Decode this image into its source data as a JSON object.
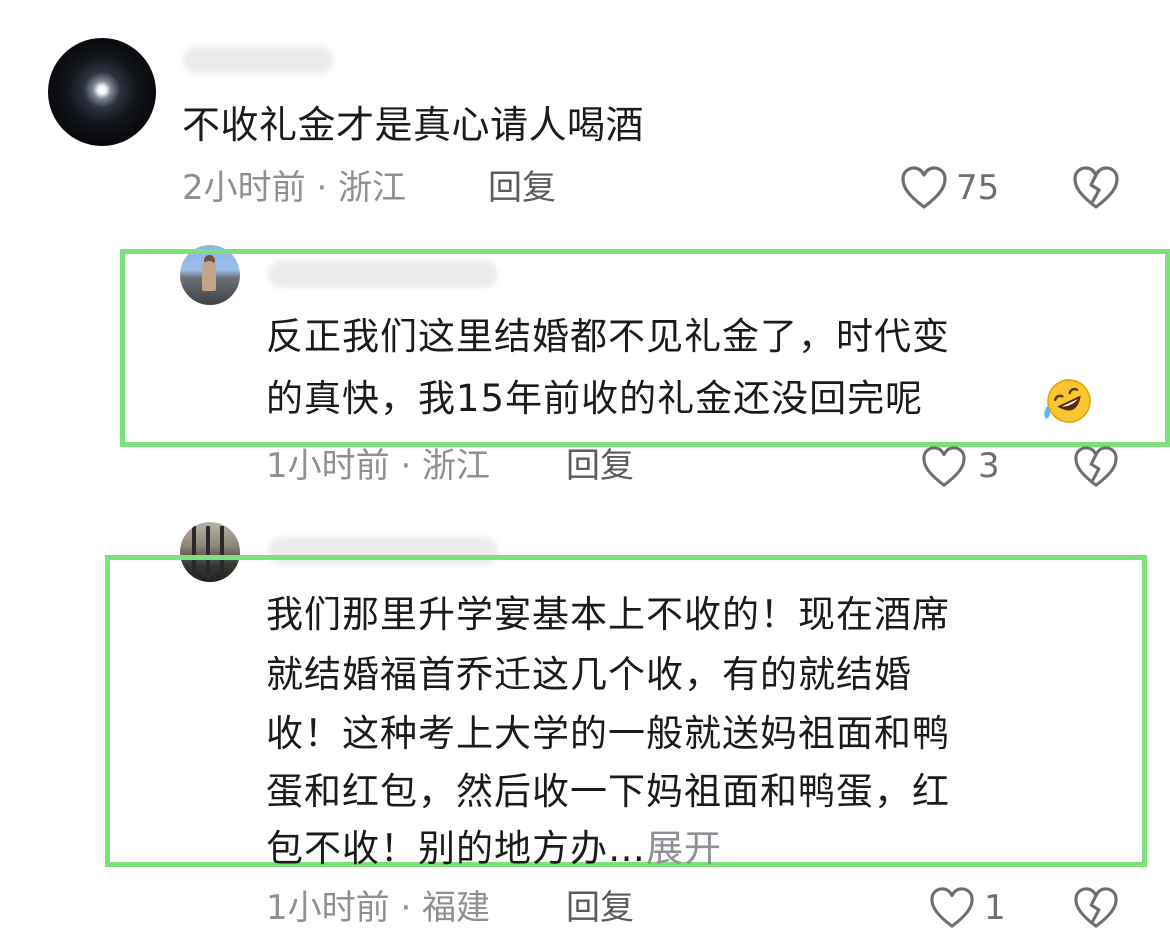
{
  "comments": [
    {
      "content": "不收礼金才是真心请人喝酒",
      "meta": "2小时前 · 浙江",
      "reply_label": "回复",
      "likes": "75"
    },
    {
      "content_line1": "反正我们这里结婚都不见礼金了，时代变",
      "content_line2": "的真快，我15年前收的礼金还没回完呢",
      "emoji": "rolling-on-floor-laughing",
      "meta": "1小时前 · 浙江",
      "reply_label": "回复",
      "likes": "3"
    },
    {
      "content_line1": "我们那里升学宴基本上不收的！现在酒席",
      "content_line2": "就结婚福首乔迁这几个收，有的就结婚",
      "content_line3": "收！这种考上大学的一般就送妈祖面和鸭",
      "content_line4": "蛋和红包，然后收一下妈祖面和鸭蛋，红",
      "content_line5": "包不收！别的地方办…",
      "expand_label": "展开",
      "meta": "1小时前 · 福建",
      "reply_label": "回复",
      "likes": "1"
    }
  ],
  "colors": {
    "highlight_border": "#7ee07b",
    "meta_text": "#8f8f94",
    "body_text": "#1b1b1b"
  },
  "icons": [
    "heart-icon",
    "broken-heart-icon",
    "laughing-emoji"
  ]
}
